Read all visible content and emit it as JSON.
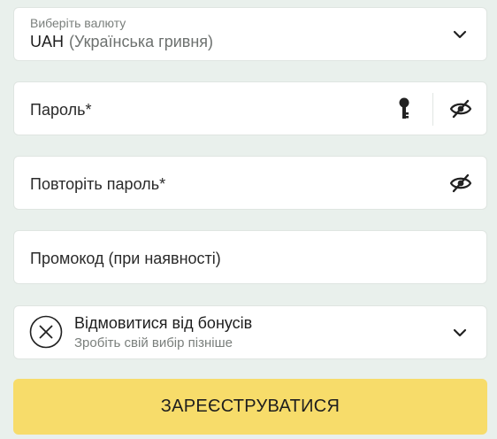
{
  "currency": {
    "label": "Виберіть валюту",
    "code": "UAH",
    "name": "(Українська гривня)"
  },
  "password": {
    "placeholder": "Пароль*"
  },
  "repeat_password": {
    "placeholder": "Повторіть пароль*"
  },
  "promo": {
    "placeholder": "Промокод (при наявності)"
  },
  "bonus": {
    "title": "Відмовитися від бонусів",
    "subtitle": "Зробіть свій вибір пізніше"
  },
  "submit": {
    "label": "ЗАРЕЄСТРУВАТИСЯ"
  },
  "colors": {
    "background": "#e9f0ec",
    "field": "#ffffff",
    "submit": "#f7dc6a",
    "muted_text": "#7a7f7c"
  },
  "icons": [
    "chevron-down-icon",
    "key-icon",
    "eye-off-icon",
    "close-circle-icon"
  ]
}
